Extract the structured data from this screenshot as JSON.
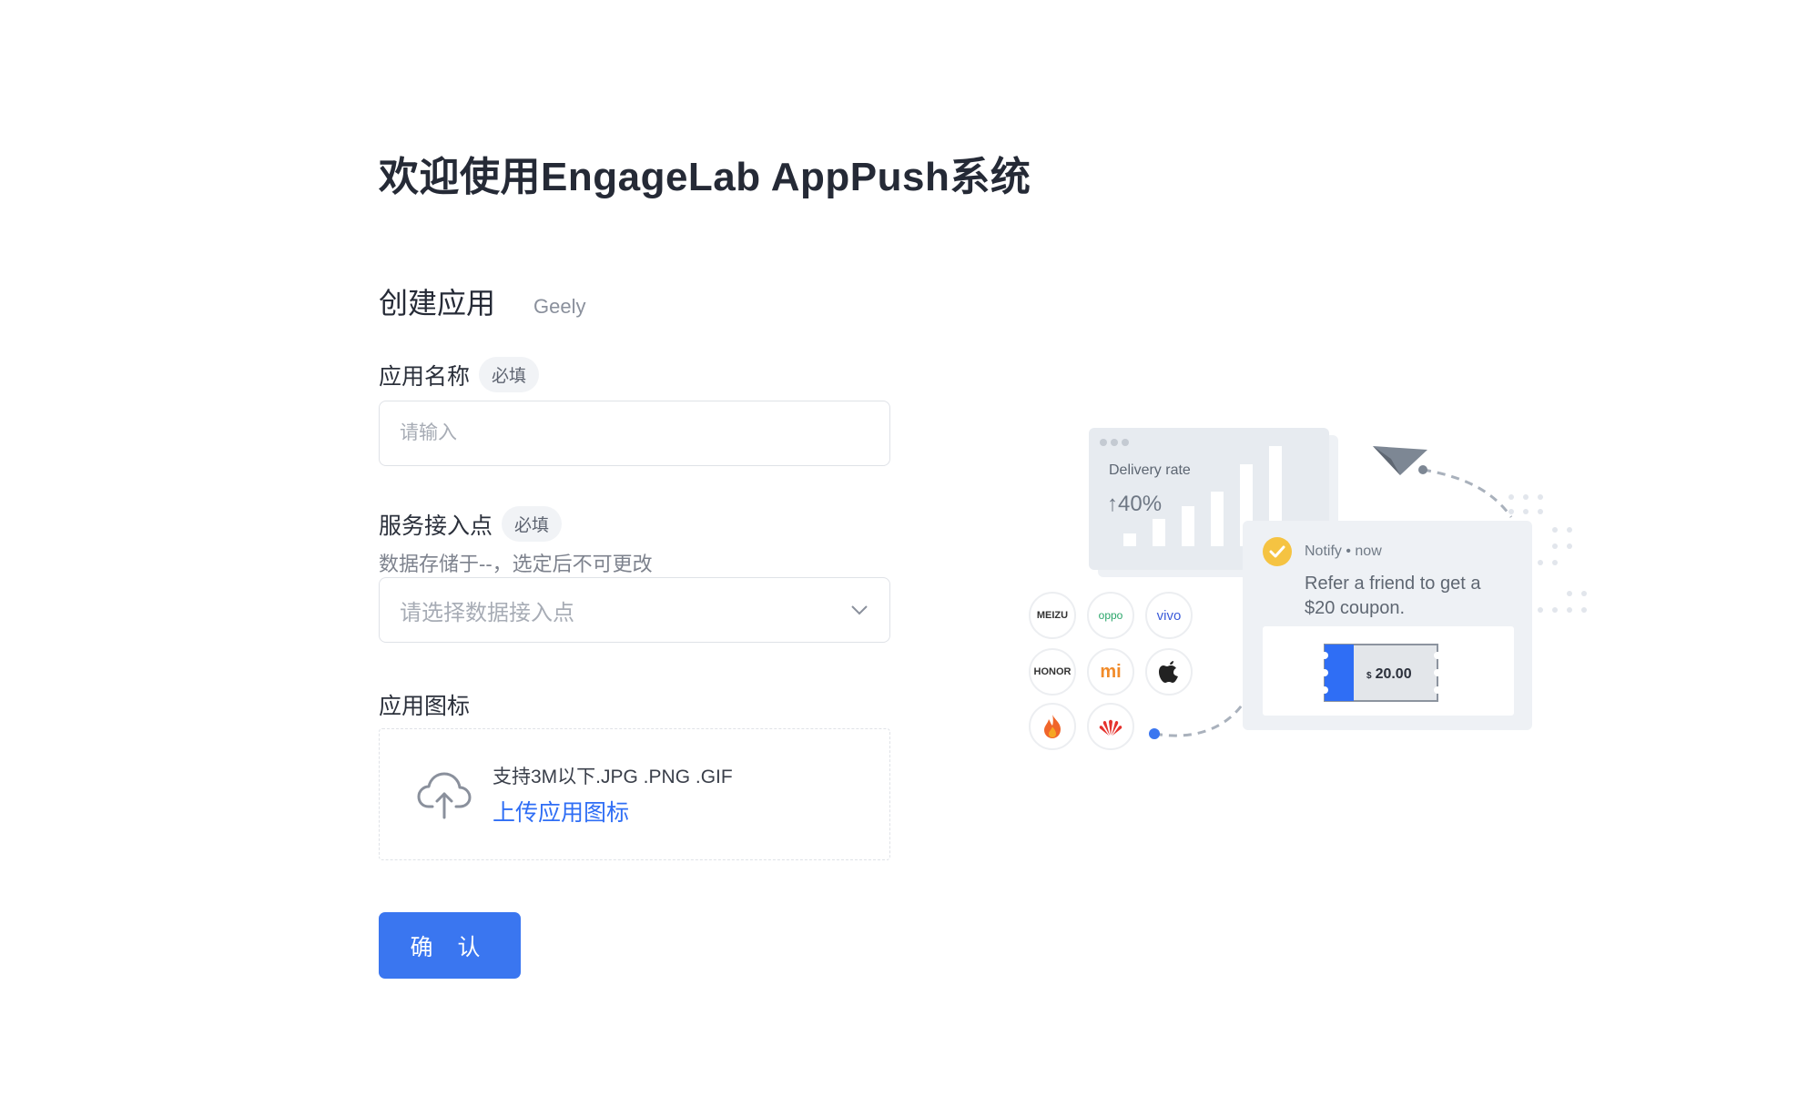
{
  "page": {
    "title": "欢迎使用EngageLab AppPush系统"
  },
  "section": {
    "title": "创建应用",
    "org": "Geely"
  },
  "form": {
    "app_name": {
      "label": "应用名称",
      "required_tag": "必填",
      "placeholder": "请输入"
    },
    "service_point": {
      "label": "服务接入点",
      "required_tag": "必填",
      "hint": "数据存储于--，选定后不可更改",
      "placeholder": "请选择数据接入点"
    },
    "app_icon": {
      "label": "应用图标",
      "hint": "支持3M以下.JPG .PNG .GIF",
      "upload_link": "上传应用图标"
    },
    "confirm_label": "确 认"
  },
  "illustration": {
    "delivery_label": "Delivery rate",
    "delivery_value": "40%",
    "notify_meta": "Notify • now",
    "notify_message": "Refer a friend to get a $20 coupon.",
    "coupon_currency": "$",
    "coupon_amount": "20.00",
    "brands": [
      "MEIZU",
      "oppo",
      "vivo",
      "HONOR",
      "mi",
      "apple",
      "flame",
      "huawei"
    ],
    "colors": {
      "accent": "#3a76f0",
      "check": "#f5c342",
      "coupon_blue": "#2f6ef5"
    }
  }
}
